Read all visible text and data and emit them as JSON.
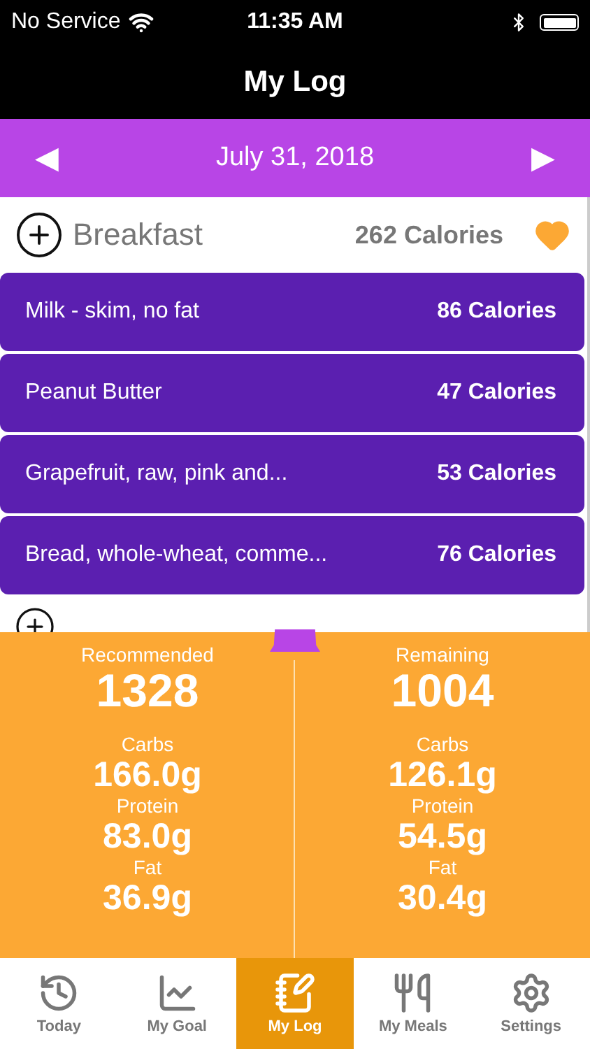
{
  "status_bar": {
    "carrier": "No Service",
    "time": "11:35 AM"
  },
  "title": "My Log",
  "date_bar": {
    "prev": "◀",
    "date": "July 31, 2018",
    "next": "▶"
  },
  "meal": {
    "name": "Breakfast",
    "calories": "262 Calories",
    "favorite": true
  },
  "foods": [
    {
      "name": "Milk - skim, no fat",
      "calories": "86 Calories"
    },
    {
      "name": "Peanut Butter",
      "calories": "47 Calories"
    },
    {
      "name": "Grapefruit, raw, pink and...",
      "calories": "53 Calories"
    },
    {
      "name": "Bread, whole-wheat, comme...",
      "calories": "76 Calories"
    }
  ],
  "summary": [
    {
      "heading": "Recommended",
      "total": "1328",
      "nutrients": [
        {
          "label": "Carbs",
          "value": "166.0g"
        },
        {
          "label": "Protein",
          "value": "83.0g"
        },
        {
          "label": "Fat",
          "value": "36.9g"
        }
      ]
    },
    {
      "heading": "Remaining",
      "total": "1004",
      "nutrients": [
        {
          "label": "Carbs",
          "value": "126.1g"
        },
        {
          "label": "Protein",
          "value": "54.5g"
        },
        {
          "label": "Fat",
          "value": "30.4g"
        }
      ]
    }
  ],
  "tabs": [
    {
      "label": "Today",
      "selected": false
    },
    {
      "label": "My Goal",
      "selected": false
    },
    {
      "label": "My Log",
      "selected": true
    },
    {
      "label": "My Meals",
      "selected": false
    },
    {
      "label": "Settings",
      "selected": false
    }
  ]
}
